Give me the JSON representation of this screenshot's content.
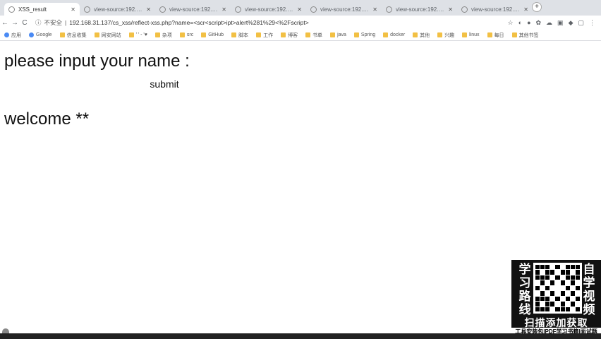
{
  "browser": {
    "tabs": [
      {
        "label": "XSS_result",
        "active": true
      },
      {
        "label": "view-source:192.168...",
        "active": false
      },
      {
        "label": "view-source:192.168...",
        "active": false
      },
      {
        "label": "view-source:192.168...",
        "active": false
      },
      {
        "label": "view-source:192.168...",
        "active": false
      },
      {
        "label": "view-source:192.168...",
        "active": false
      },
      {
        "label": "view-source:192.168...",
        "active": false
      }
    ],
    "new_tab": "+",
    "back": "←",
    "forward": "→",
    "reload": "C",
    "security_label": "不安全",
    "url": "192.168.31.137/cs_xss/reflect-xss.php?name=<scr<script>ipt>alert%281%29<%2Fscript>",
    "bookmarks": [
      "应用",
      "Google",
      "信息收集",
      "网安网站",
      "' ' - '♥",
      "杂项",
      "src",
      "GitHub",
      "脚本",
      "工作",
      "博客",
      "书单",
      "java",
      "Spring",
      "docker",
      "其他",
      "兴趣",
      "linux",
      "每日",
      "其他书签"
    ]
  },
  "page": {
    "prompt": "please input your name :",
    "submit_label": "submit",
    "welcome": "welcome **"
  },
  "promo": {
    "left_text": "学习路线",
    "right_text": "自学视频",
    "title": "扫描添加获取",
    "subtitle": "工具安装包|PDF学习书籍|面试题"
  }
}
